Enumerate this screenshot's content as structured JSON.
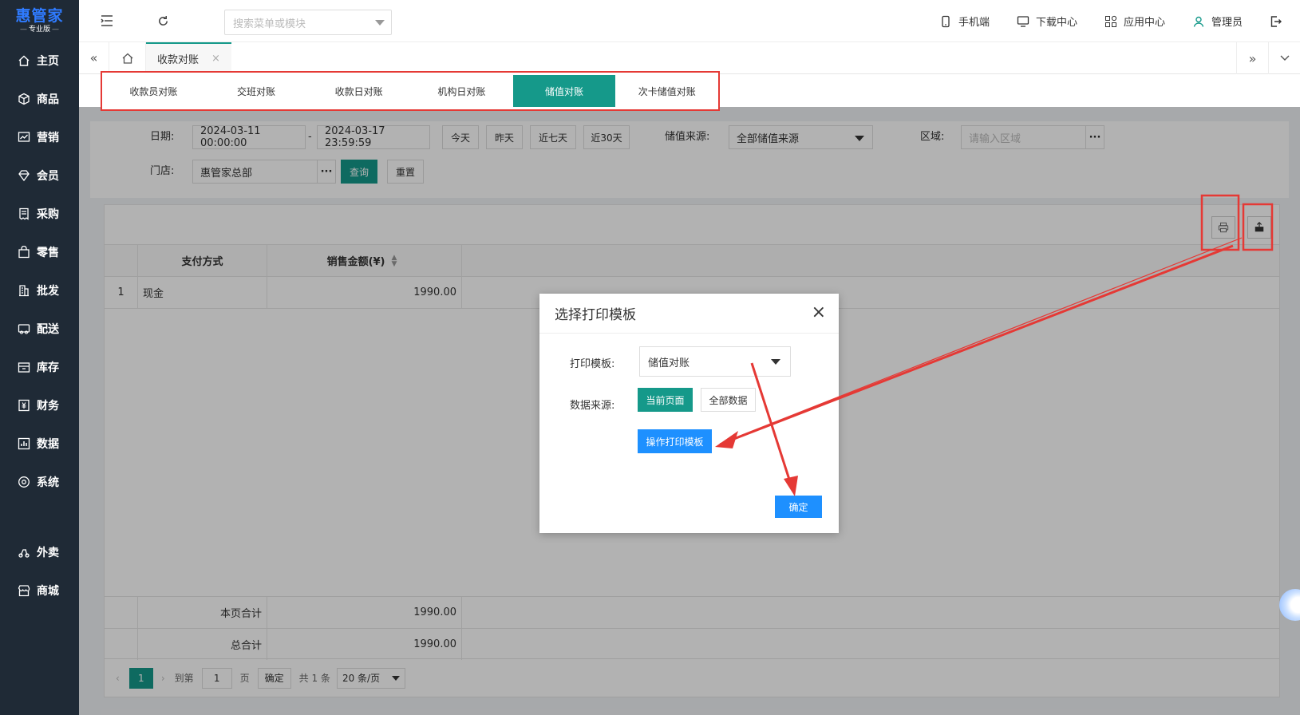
{
  "sidebar": {
    "logo": "惠管家",
    "logo_sub": "专业版",
    "items": [
      {
        "label": "主页",
        "icon": "home-icon"
      },
      {
        "label": "商品",
        "icon": "box-icon"
      },
      {
        "label": "营销",
        "icon": "chart-icon"
      },
      {
        "label": "会员",
        "icon": "diamond-icon"
      },
      {
        "label": "采购",
        "icon": "receipt-icon"
      },
      {
        "label": "零售",
        "icon": "bag-icon"
      },
      {
        "label": "批发",
        "icon": "building-icon"
      },
      {
        "label": "配送",
        "icon": "truck-icon"
      },
      {
        "label": "库存",
        "icon": "inventory-icon"
      },
      {
        "label": "财务",
        "icon": "finance-icon"
      },
      {
        "label": "数据",
        "icon": "data-icon"
      },
      {
        "label": "系统",
        "icon": "settings-icon"
      },
      {
        "label": "外卖",
        "icon": "delivery-icon"
      },
      {
        "label": "商城",
        "icon": "store-icon"
      }
    ]
  },
  "topbar": {
    "search_placeholder": "搜索菜单或模块",
    "mobile": "手机端",
    "download": "下载中心",
    "apps": "应用中心",
    "user": "管理员"
  },
  "tabstrip": {
    "active_tab": "收款对账",
    "close": "×"
  },
  "subtabs": [
    "收款员对账",
    "交班对账",
    "收款日对账",
    "机构日对账",
    "储值对账",
    "次卡储值对账"
  ],
  "filters": {
    "date_label": "日期:",
    "date_start": "2024-03-11 00:00:00",
    "date_sep": "-",
    "date_end": "2024-03-17 23:59:59",
    "today": "今天",
    "yesterday": "昨天",
    "last7": "近七天",
    "last30": "近30天",
    "source_label": "储值来源:",
    "source_value": "全部储值来源",
    "region_label": "区域:",
    "region_placeholder": "请输入区域",
    "store_label": "门店:",
    "store_value": "惠管家总部",
    "query": "查询",
    "reset": "重置",
    "dots": "···"
  },
  "table": {
    "headers": [
      "支付方式",
      "销售金额(¥)"
    ],
    "rows": [
      {
        "index": "1",
        "method": "现金",
        "amount": "1990.00"
      }
    ],
    "page_total_label": "本页合计",
    "page_total": "1990.00",
    "grand_total_label": "总合计",
    "grand_total": "1990.00"
  },
  "pager": {
    "current": "1",
    "goto_label": "到第",
    "goto_value": "1",
    "page_unit": "页",
    "confirm": "确定",
    "total": "共 1 条",
    "page_size": "20 条/页"
  },
  "modal": {
    "title": "选择打印模板",
    "template_label": "打印模板:",
    "template_value": "储值对账",
    "source_label": "数据来源:",
    "current_page": "当前页面",
    "all_data": "全部数据",
    "edit_template": "操作打印模板",
    "ok": "确定",
    "close": "×"
  },
  "colors": {
    "primary": "#15998a",
    "sidebar_bg": "#1f2a36",
    "logo": "#2f7bff",
    "annotation_red": "#e53935",
    "blue_btn": "#1e90ff"
  }
}
